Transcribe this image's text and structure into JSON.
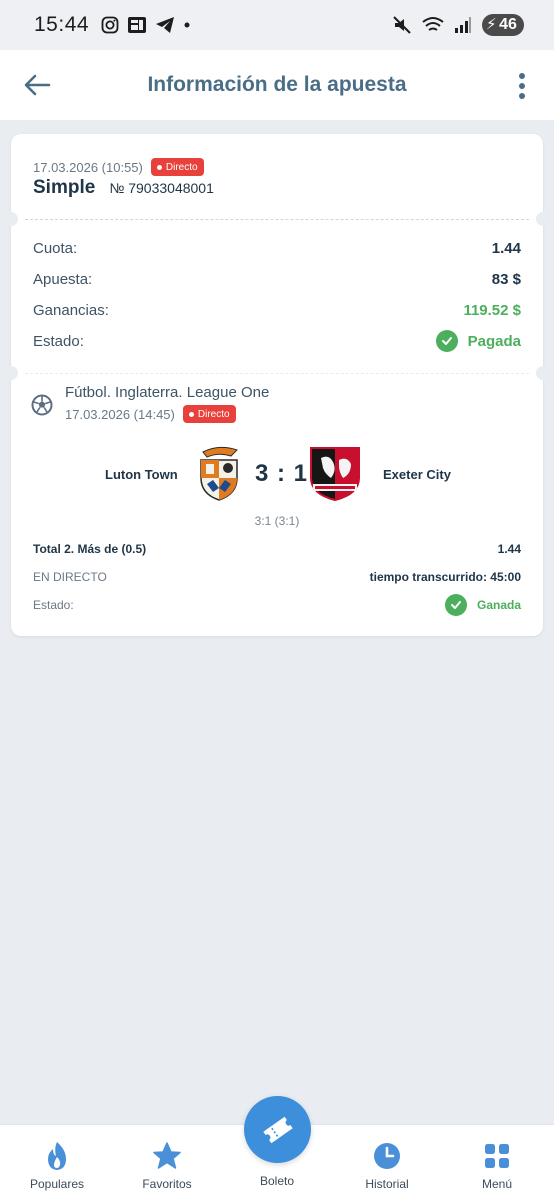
{
  "status_bar": {
    "time": "15:44",
    "battery": "46"
  },
  "header": {
    "title": "Información de la apuesta"
  },
  "bet": {
    "datetime": "17.03.2026 (10:55)",
    "live_badge": "Directo",
    "type": "Simple",
    "number": "№ 79033048001",
    "rows": [
      {
        "label": "Cuota:",
        "value": "1.44"
      },
      {
        "label": "Apuesta:",
        "value": "83 $"
      },
      {
        "label": "Ganancias:",
        "value": "119.52 $"
      }
    ],
    "status_label": "Estado:",
    "status_value": "Pagada"
  },
  "event": {
    "league": "Fútbol. Inglaterra. League One",
    "datetime": "17.03.2026 (14:45)",
    "live_badge": "Directo",
    "home_team": "Luton Town",
    "away_team": "Exeter City",
    "score": "3 : 1",
    "half_score": "3:1 (3:1)",
    "market": "Total 2. Más de (0.5)",
    "market_odds": "1.44",
    "mode": "EN DIRECTO",
    "elapsed": "tiempo transcurrido: 45:00",
    "status_label": "Estado:",
    "status_value": "Ganada"
  },
  "nav": {
    "items": [
      {
        "label": "Populares",
        "icon": "flame-icon"
      },
      {
        "label": "Favoritos",
        "icon": "star-icon"
      },
      {
        "label": "Boleto",
        "icon": "ticket-icon"
      },
      {
        "label": "Historial",
        "icon": "clock-icon"
      },
      {
        "label": "Menú",
        "icon": "grid-icon"
      }
    ]
  },
  "colors": {
    "accent": "#3d8fdc",
    "green": "#4caf5d",
    "live": "#e8413c",
    "title": "#4a6e86"
  }
}
